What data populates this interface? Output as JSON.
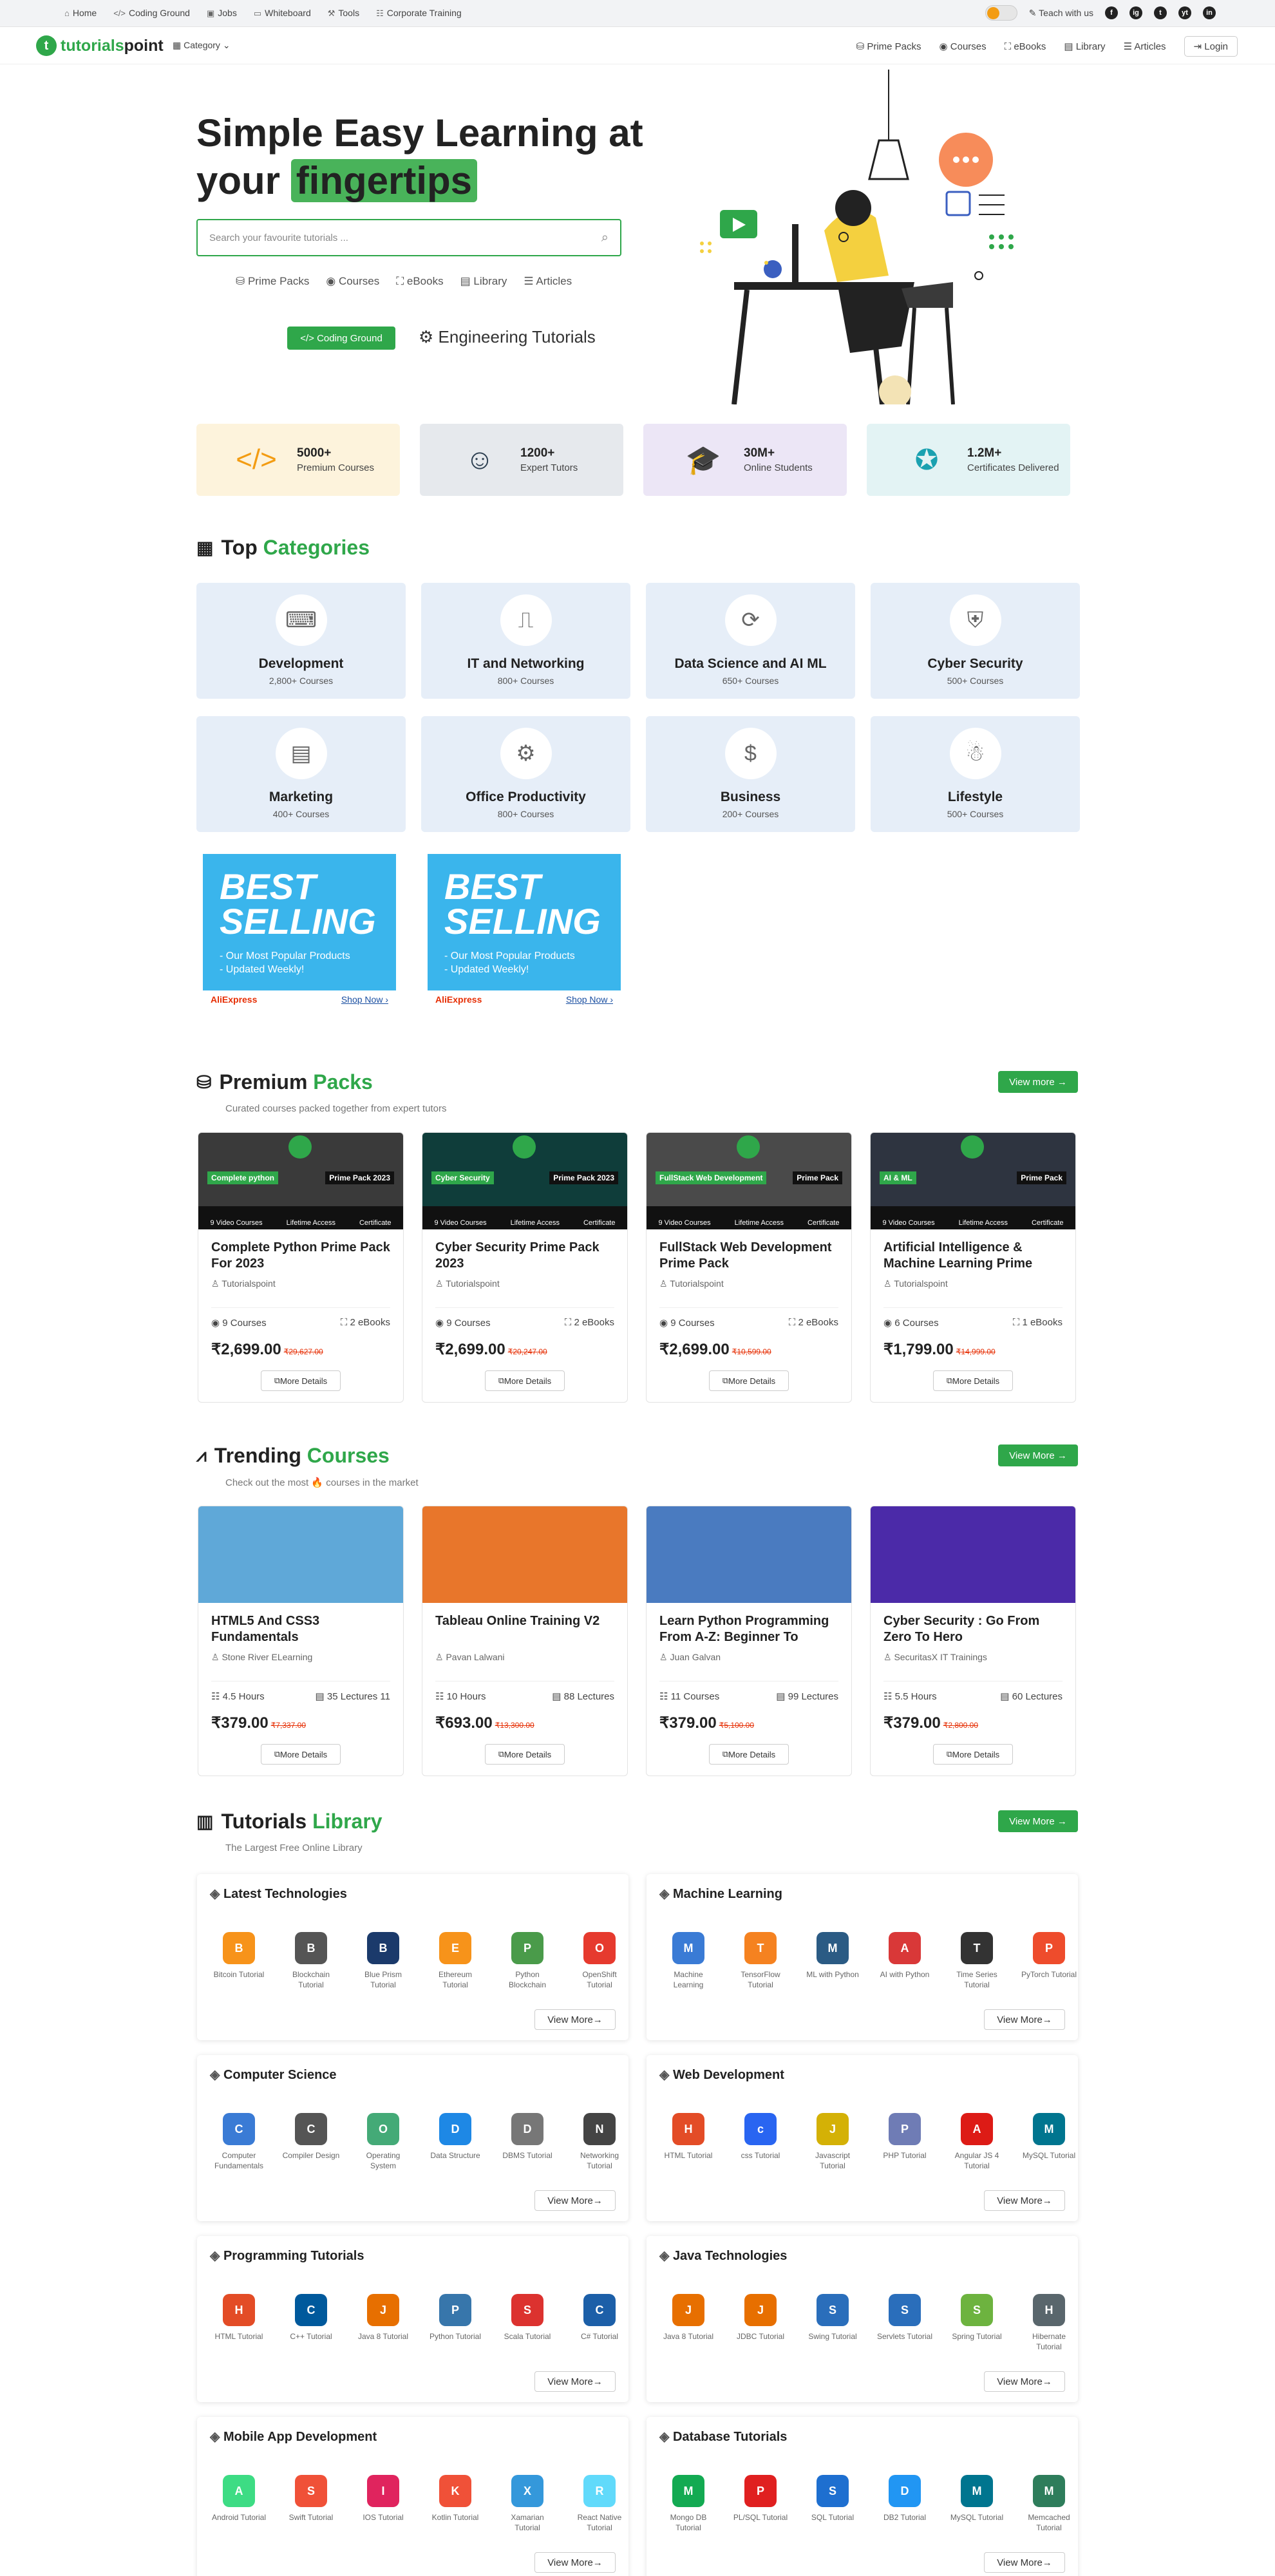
{
  "topbar": {
    "links": [
      "Home",
      "Coding Ground",
      "Jobs",
      "Whiteboard",
      "Tools",
      "Corporate Training"
    ],
    "teach": "Teach with us",
    "social": [
      "f",
      "ig",
      "t",
      "yt",
      "in"
    ]
  },
  "nav": {
    "logo_a": "tutorials",
    "logo_b": "point",
    "category": "Category",
    "links": [
      "Prime Packs",
      "Courses",
      "eBooks",
      "Library",
      "Articles"
    ],
    "login": "Login"
  },
  "hero": {
    "title1": "Simple Easy Learning at",
    "title2a": "your",
    "title2b": "fingertips",
    "search_placeholder": "Search your favourite tutorials ...",
    "quick": [
      "Prime Packs",
      "Courses",
      "eBooks",
      "Library",
      "Articles"
    ],
    "coding_ground": "Coding Ground",
    "engineering": "Engineering Tutorials"
  },
  "stats": [
    {
      "num": "5000+",
      "label": "Premium Courses",
      "color": "#fdf3dc",
      "icon": "</>"
    },
    {
      "num": "1200+",
      "label": "Expert Tutors",
      "color": "#e6e9ed",
      "icon": "☺"
    },
    {
      "num": "30M+",
      "label": "Online Students",
      "color": "#ece6f6",
      "icon": "🎓"
    },
    {
      "num": "1.2M+",
      "label": "Certificates Delivered",
      "color": "#e3f3f4",
      "icon": "✪"
    }
  ],
  "categories": {
    "title_a": "Top",
    "title_b": "Categories",
    "items": [
      {
        "name": "Development",
        "count": "2,800+ Courses"
      },
      {
        "name": "IT and Networking",
        "count": "800+ Courses"
      },
      {
        "name": "Data Science and AI ML",
        "count": "650+ Courses"
      },
      {
        "name": "Cyber Security",
        "count": "500+ Courses"
      },
      {
        "name": "Marketing",
        "count": "400+ Courses"
      },
      {
        "name": "Office Productivity",
        "count": "800+ Courses"
      },
      {
        "name": "Business",
        "count": "200+ Courses"
      },
      {
        "name": "Lifestyle",
        "count": "500+ Courses"
      }
    ]
  },
  "ads": [
    {
      "big1": "BEST",
      "big2": "SELLING",
      "line1": "- Our Most Popular Products",
      "line2": "- Updated Weekly!",
      "brand": "AliExpress",
      "shop": "Shop Now ›"
    },
    {
      "big1": "BEST",
      "big2": "SELLING",
      "line1": "- Our Most Popular Products",
      "line2": "- Updated Weekly!",
      "brand": "AliExpress",
      "shop": "Shop Now ›"
    }
  ],
  "packs": {
    "title_a": "Premium",
    "title_b": "Packs",
    "subtitle": "Curated courses packed together from expert tutors",
    "view_more": "View more",
    "items": [
      {
        "title": "Complete Python Prime Pack For 2023",
        "author": "Tutorialspoint",
        "courses": "9 Courses",
        "ebooks": "2 eBooks",
        "price": "₹2,699.00",
        "old": "₹29,627.00",
        "tag": "Complete python",
        "pack": "Prime Pack 2023",
        "bg": "#3a3a3a"
      },
      {
        "title": "Cyber Security Prime Pack 2023",
        "author": "Tutorialspoint",
        "courses": "9 Courses",
        "ebooks": "2 eBooks",
        "price": "₹2,699.00",
        "old": "₹20,247.00",
        "tag": "Cyber Security",
        "pack": "Prime Pack 2023",
        "bg": "#0f3d3a"
      },
      {
        "title": "FullStack Web Development Prime Pack",
        "author": "Tutorialspoint",
        "courses": "9 Courses",
        "ebooks": "2 eBooks",
        "price": "₹2,699.00",
        "old": "₹10,599.00",
        "tag": "FullStack Web Development",
        "pack": "Prime Pack",
        "bg": "#4a4a4a"
      },
      {
        "title": "Artificial Intelligence & Machine Learning Prime",
        "author": "Tutorialspoint",
        "courses": "6 Courses",
        "ebooks": "1 eBooks",
        "price": "₹1,799.00",
        "old": "₹14,999.00",
        "tag": "AI & ML",
        "pack": "Prime Pack",
        "bg": "#2e3440"
      }
    ],
    "strip": [
      "9 Video Courses",
      "Lifetime Access",
      "Certificate"
    ],
    "details": "More Details"
  },
  "trending": {
    "title_a": "Trending",
    "title_b": "Courses",
    "subtitle": "Check out the most 🔥 courses in the market",
    "view_more": "View More",
    "items": [
      {
        "title": "HTML5 And CSS3 Fundamentals",
        "author": "Stone River ELearning",
        "m1": "4.5 Hours",
        "m2": "35 Lectures 11",
        "price": "₹379.00",
        "old": "₹7,337.00",
        "bg": "#5fa8d8"
      },
      {
        "title": "Tableau Online Training V2",
        "author": "Pavan Lalwani",
        "m1": "10 Hours",
        "m2": "88 Lectures",
        "price": "₹693.00",
        "old": "₹13,300.00",
        "bg": "#e8762b"
      },
      {
        "title": "Learn Python Programming From A-Z: Beginner To",
        "author": "Juan Galvan",
        "m1": "11 Courses",
        "m2": "99 Lectures",
        "price": "₹379.00",
        "old": "₹5,100.00",
        "bg": "#4a7bc0"
      },
      {
        "title": "Cyber Security : Go From Zero To Hero",
        "author": "SecuritasX IT Trainings",
        "m1": "5.5 Hours",
        "m2": "60 Lectures",
        "price": "₹379.00",
        "old": "₹2,800.00",
        "bg": "#4b2aa8"
      }
    ],
    "details": "More Details"
  },
  "library": {
    "title_a": "Tutorials",
    "title_b": "Library",
    "subtitle": "The Largest Free Online Library",
    "view_more": "View More",
    "box_view": "View More",
    "boxes": [
      {
        "title": "Latest Technologies",
        "items": [
          "Bitcoin Tutorial",
          "Blockchain Tutorial",
          "Blue Prism Tutorial",
          "Ethereum Tutorial",
          "Python Blockchain",
          "OpenShift Tutorial"
        ],
        "colors": [
          "#f7931a",
          "#555",
          "#1b3a6b",
          "#f7931a",
          "#4a9b4a",
          "#e63a2e"
        ]
      },
      {
        "title": "Machine Learning",
        "items": [
          "Machine Learning",
          "TensorFlow Tutorial",
          "ML with Python",
          "AI with Python",
          "Time Series Tutorial",
          "PyTorch Tutorial"
        ],
        "colors": [
          "#3a7bd5",
          "#f58220",
          "#2b5b84",
          "#d93838",
          "#333",
          "#ee4c2c"
        ]
      },
      {
        "title": "Computer Science",
        "items": [
          "Computer Fundamentals",
          "Compiler Design",
          "Operating System",
          "Data Structure",
          "DBMS Tutorial",
          "Networking Tutorial"
        ],
        "colors": [
          "#3a7bd5",
          "#555",
          "#4a7",
          "#1e88e5",
          "#777",
          "#444"
        ]
      },
      {
        "title": "Web Development",
        "items": [
          "HTML Tutorial",
          "css Tutorial",
          "Javascript Tutorial",
          "PHP Tutorial",
          "Angular JS 4 Tutorial",
          "MySQL Tutorial"
        ],
        "colors": [
          "#e34c26",
          "#2965f1",
          "#d4b106",
          "#6f7cb5",
          "#dd1b16",
          "#00758f"
        ]
      },
      {
        "title": "Programming Tutorials",
        "items": [
          "HTML Tutorial",
          "C++ Tutorial",
          "Java 8 Tutorial",
          "Python Tutorial",
          "Scala Tutorial",
          "C# Tutorial"
        ],
        "colors": [
          "#e34c26",
          "#00599c",
          "#e76f00",
          "#3776ab",
          "#dc322f",
          "#1c5fa8"
        ]
      },
      {
        "title": "Java Technologies",
        "items": [
          "Java 8 Tutorial",
          "JDBC Tutorial",
          "Swing Tutorial",
          "Servlets Tutorial",
          "Spring Tutorial",
          "Hibernate Tutorial"
        ],
        "colors": [
          "#e76f00",
          "#e76f00",
          "#2a6ebb",
          "#2a6ebb",
          "#6db33f",
          "#59666c"
        ]
      },
      {
        "title": "Mobile App Development",
        "items": [
          "Android Tutorial",
          "Swift Tutorial",
          "IOS Tutorial",
          "Kotlin Tutorial",
          "Xamarian Tutorial",
          "React Native Tutorial"
        ],
        "colors": [
          "#3ddc84",
          "#f05138",
          "#e0245e",
          "#f05138",
          "#3498db",
          "#61dafb"
        ]
      },
      {
        "title": "Database Tutorials",
        "items": [
          "Mongo DB Tutorial",
          "PL/SQL Tutorial",
          "SQL Tutorial",
          "DB2 Tutorial",
          "MySQL Tutorial",
          "Memcached Tutorial"
        ],
        "colors": [
          "#13aa52",
          "#e02020",
          "#1e6fd0",
          "#2196f3",
          "#00758f",
          "#2e7d5b"
        ]
      }
    ]
  }
}
